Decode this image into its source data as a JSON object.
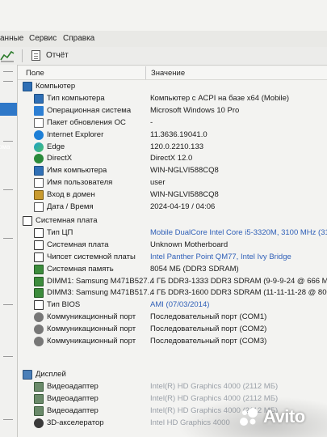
{
  "menu": {
    "items": [
      "анные",
      "Сервис",
      "Справка"
    ]
  },
  "toolbar": {
    "report_label": "Отчёт"
  },
  "left_pane": {
    "selected_fragment": "рма"
  },
  "columns": {
    "field": "Поле",
    "value": "Значение"
  },
  "sections": [
    {
      "label": "Компьютер",
      "icon": "computer-icon",
      "rows": [
        {
          "label": "Тип компьютера",
          "value": "Компьютер с ACPI на базе x64  (Mobile)",
          "icon": "computer-icon",
          "value_color": "normal"
        },
        {
          "label": "Операционная система",
          "value": "Microsoft Windows 10 Pro",
          "icon": "windows-icon",
          "value_color": "normal"
        },
        {
          "label": "Пакет обновления ОС",
          "value": "-",
          "icon": "document-icon",
          "value_color": "normal"
        },
        {
          "label": "Internet Explorer",
          "value": "11.3636.19041.0",
          "icon": "ie-icon",
          "value_color": "normal"
        },
        {
          "label": "Edge",
          "value": "120.0.2210.133",
          "icon": "edge-icon",
          "value_color": "normal"
        },
        {
          "label": "DirectX",
          "value": "DirectX 12.0",
          "icon": "directx-icon",
          "value_color": "normal"
        },
        {
          "label": "Имя компьютера",
          "value": "WIN-NGLVI588CQ8",
          "icon": "computer-icon",
          "value_color": "normal"
        },
        {
          "label": "Имя пользователя",
          "value": "user",
          "icon": "user-icon",
          "value_color": "normal"
        },
        {
          "label": "Вход в домен",
          "value": "WIN-NGLVI588CQ8",
          "icon": "domain-icon",
          "value_color": "normal"
        },
        {
          "label": "Дата / Время",
          "value": "2024-04-19 / 04:06",
          "icon": "calendar-icon",
          "value_color": "normal"
        }
      ]
    },
    {
      "label": "Системная плата",
      "icon": "motherboard-icon",
      "rows": [
        {
          "label": "Тип ЦП",
          "value": "Mobile DualCore Intel Core i5-3320M, 3100 MHz (31 x",
          "icon": "cpu-icon",
          "value_color": "blue"
        },
        {
          "label": "Системная плата",
          "value": "Unknown Motherboard",
          "icon": "motherboard-icon",
          "value_color": "normal"
        },
        {
          "label": "Чипсет системной платы",
          "value": "Intel Panther Point QM77, Intel Ivy Bridge",
          "icon": "chipset-icon",
          "value_color": "blue"
        },
        {
          "label": "Системная память",
          "value": "8054 МБ  (DDR3 SDRAM)",
          "icon": "memory-icon",
          "value_color": "normal"
        },
        {
          "label": "DIMM1: Samsung M471B527...",
          "value": "4 ГБ DDR3-1333 DDR3 SDRAM  (9-9-9-24 @ 666 МГц)",
          "icon": "memory-icon",
          "value_color": "normal"
        },
        {
          "label": "DIMM3: Samsung M471B517...",
          "value": "4 ГБ DDR3-1600 DDR3 SDRAM  (11-11-11-28 @ 800 МГ",
          "icon": "memory-icon",
          "value_color": "normal"
        },
        {
          "label": "Тип BIOS",
          "value": "AMI (07/03/2014)",
          "icon": "bios-icon",
          "value_color": "blue"
        },
        {
          "label": "Коммуникационный порт",
          "value": "Последовательный порт (COM1)",
          "icon": "port-icon",
          "value_color": "normal"
        },
        {
          "label": "Коммуникационный порт",
          "value": "Последовательный порт (COM2)",
          "icon": "port-icon",
          "value_color": "normal"
        },
        {
          "label": "Коммуникационный порт",
          "value": "Последовательный порт (COM3)",
          "icon": "port-icon",
          "value_color": "normal"
        }
      ]
    },
    {
      "label": "Дисплей",
      "icon": "display-icon",
      "rows": [
        {
          "label": "Видеоадаптер",
          "value": "Intel(R) HD Graphics 4000  (2112 МБ)",
          "icon": "display-adapter-icon",
          "value_color": "dim"
        },
        {
          "label": "Видеоадаптер",
          "value": "Intel(R) HD Graphics 4000  (2112 МБ)",
          "icon": "display-adapter-icon",
          "value_color": "dim"
        },
        {
          "label": "Видеоадаптер",
          "value": "Intel(R) HD Graphics 4000  (2112 МБ)",
          "icon": "display-adapter-icon",
          "value_color": "dim"
        },
        {
          "label": "3D-акселератор",
          "value": "Intel HD Graphics 4000",
          "icon": "xbox-icon",
          "value_color": "dim"
        }
      ]
    }
  ],
  "watermark": {
    "brand": "Avito"
  },
  "colors": {
    "link_blue": "#3060b8",
    "selection": "#2f78c8"
  }
}
